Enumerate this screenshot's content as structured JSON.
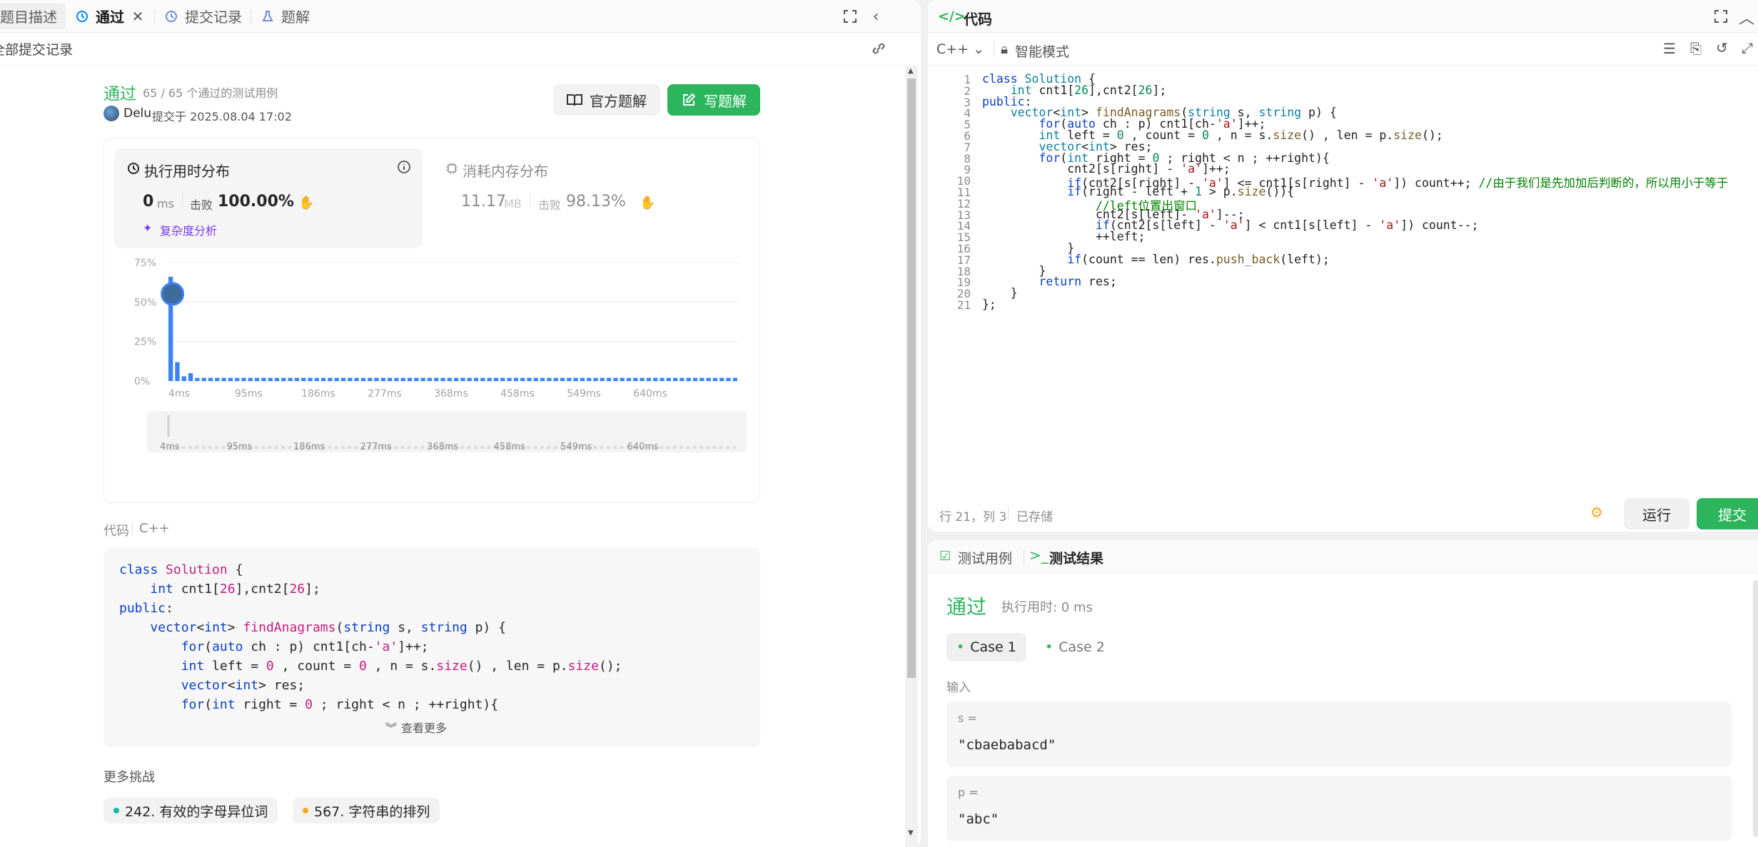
{
  "left_tabs": {
    "desc": "题目描述",
    "pass": "通过",
    "submissions": "提交记录",
    "solutions": "题解"
  },
  "subheader": {
    "all_submissions": "全部提交记录"
  },
  "result": {
    "status": "通过",
    "testcases": "65 / 65 个通过的测试用例",
    "user": "Delu",
    "submitted": "提交于 2025.08.04 17:02"
  },
  "buttons": {
    "official": "官方题解",
    "write": "写题解",
    "run": "运行",
    "submit": "提交",
    "more": "查看更多"
  },
  "runtime": {
    "title": "执行用时分布",
    "value": "0",
    "unit": "ms",
    "beats_label": "击败",
    "beats": "100.00%",
    "analysis": "复杂度分析"
  },
  "memory": {
    "title": "消耗内存分布",
    "value": "11.17",
    "unit": "MB",
    "beats_label": "击败",
    "beats": "98.13%"
  },
  "chart_data": {
    "type": "bar",
    "title": "",
    "xlabel": "",
    "ylabel": "",
    "yticks": [
      "75%",
      "50%",
      "25%",
      "0%"
    ],
    "ylim": [
      0,
      75
    ],
    "xticks": [
      "4ms",
      "95ms",
      "186ms",
      "277ms",
      "368ms",
      "458ms",
      "549ms",
      "640ms"
    ],
    "series": [
      {
        "values": [
          66,
          12,
          3,
          5,
          2,
          2,
          2,
          2,
          2,
          2,
          2,
          2,
          2,
          2,
          2,
          2,
          2,
          2,
          2,
          2,
          2,
          2,
          2,
          2,
          2,
          2,
          2,
          2,
          2,
          2,
          2,
          2,
          2,
          2,
          2,
          2,
          2,
          2,
          2,
          2,
          2,
          2,
          2,
          2,
          2,
          2,
          2,
          2,
          2,
          2,
          2,
          2,
          2,
          2,
          2,
          2,
          2,
          2,
          2,
          2,
          2,
          2,
          2,
          2,
          2,
          2,
          2,
          2,
          2,
          2,
          2,
          2,
          2,
          2,
          2,
          2,
          2,
          2,
          2,
          2,
          2,
          2,
          2,
          2,
          2,
          2
        ]
      }
    ],
    "grid": true,
    "color": "#3b82f6",
    "highlight_index": 0
  },
  "code_section": {
    "label": "代码",
    "lang": "C++"
  },
  "submitted_code": [
    "class Solution {",
    "    int cnt1[26],cnt2[26];",
    "public:",
    "    vector<int> findAnagrams(string s, string p) {",
    "        for(auto ch : p) cnt1[ch-'a']++;",
    "        int left = 0 , count = 0 , n = s.size() , len = p.size();",
    "        vector<int> res;",
    "        for(int right = 0 ; right < n ; ++right){"
  ],
  "more_challenges": {
    "title": "更多挑战",
    "items": [
      {
        "label": "242. 有效的字母异位词",
        "dot": "#14b8a6"
      },
      {
        "label": "567. 字符串的排列",
        "dot": "#f5a623"
      }
    ]
  },
  "editor": {
    "title": "代码",
    "lang": "C++",
    "mode": "智能模式",
    "lines": [
      "class Solution {",
      "    int cnt1[26],cnt2[26];",
      "public:",
      "    vector<int> findAnagrams(string s, string p) {",
      "        for(auto ch : p) cnt1[ch-'a']++;",
      "        int left = 0 , count = 0 , n = s.size() , len = p.size();",
      "        vector<int> res;",
      "        for(int right = 0 ; right < n ; ++right){",
      "            cnt2[s[right] - 'a']++;",
      "            if(cnt2[s[right] - 'a'] <= cnt1[s[right] - 'a']) count++; //由于我们是先加加后判断的，所以用小于等于",
      "            if(right - left + 1 > p.size()){",
      "                //left位置出窗口",
      "                cnt2[s[left]- 'a']--;",
      "                if(cnt2[s[left] - 'a'] < cnt1[s[left] - 'a']) count--;",
      "                ++left;",
      "            }",
      "            if(count == len) res.push_back(left);",
      "        }",
      "        return res;",
      "    }",
      "};"
    ],
    "status_pos": "行 21，列 3",
    "status_saved": "已存储"
  },
  "tests": {
    "tab_cases": "测试用例",
    "tab_result": "测试结果",
    "status": "通过",
    "runtime": "执行用时: 0 ms",
    "cases": [
      "Case 1",
      "Case 2"
    ],
    "input_label": "输入",
    "vars": [
      {
        "name": "s =",
        "value": "\"cbaebabacd\""
      },
      {
        "name": "p =",
        "value": "\"abc\""
      }
    ]
  }
}
